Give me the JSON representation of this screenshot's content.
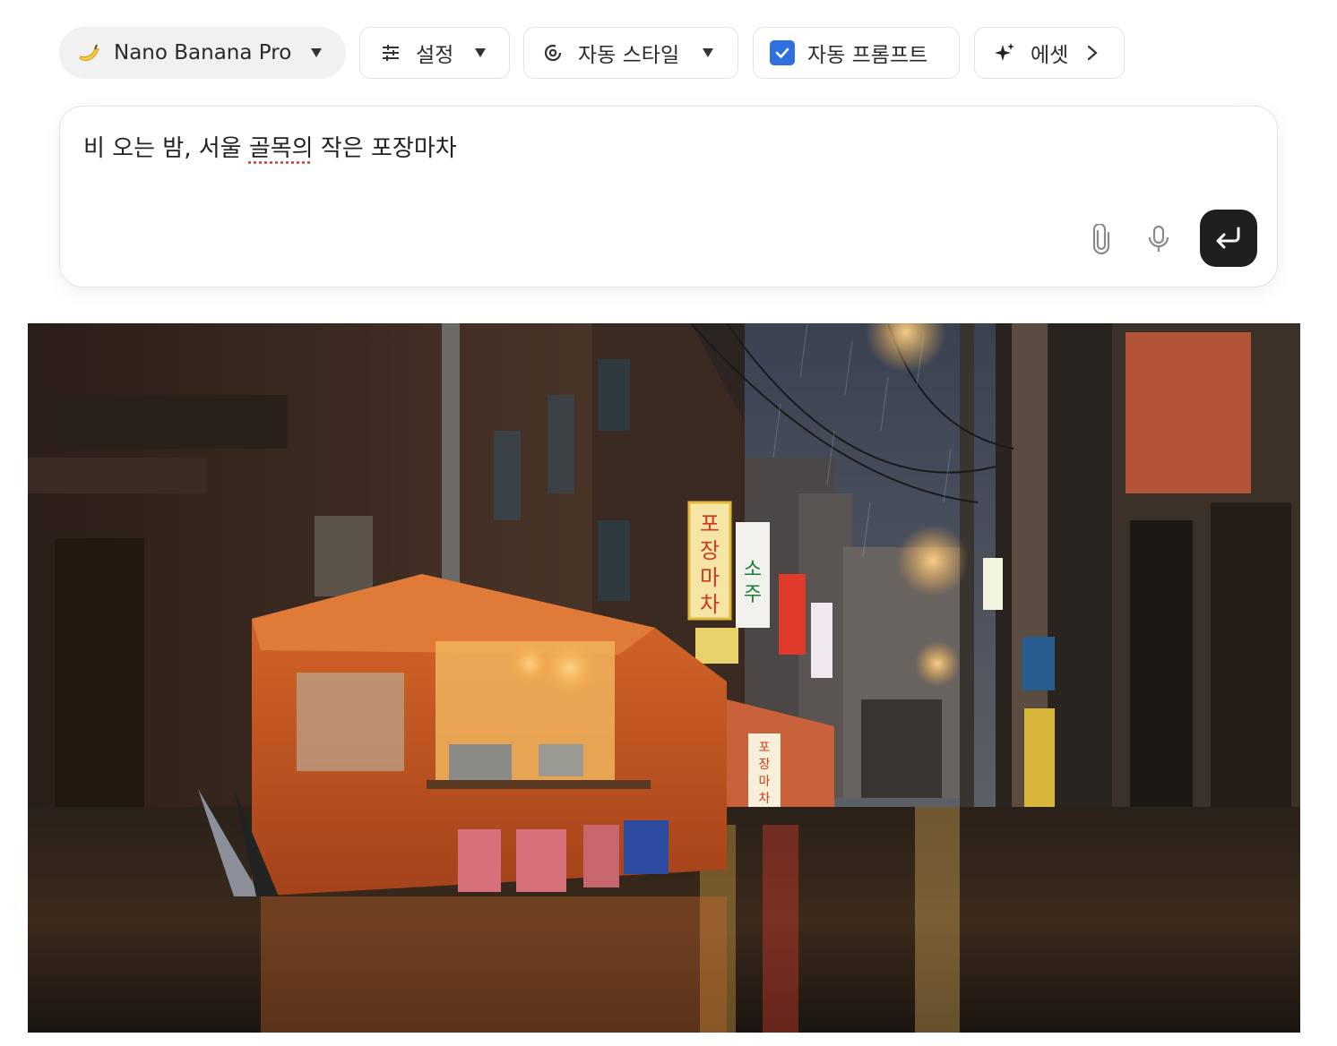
{
  "toolbar": {
    "model": {
      "icon": "banana-icon",
      "label": "Nano Banana Pro"
    },
    "settings": {
      "icon": "sliders-icon",
      "label": "설정"
    },
    "style": {
      "icon": "style-swirl-icon",
      "label": "자동 스타일"
    },
    "auto_prompt": {
      "checked": true,
      "label": "자동 프롬프트"
    },
    "preset": {
      "icon": "sparkle-icon",
      "label": "에셋"
    }
  },
  "composer": {
    "prompt_before": "비 오는 밤, 서울 ",
    "prompt_flagged": "골목의",
    "prompt_after": " 작은 포장마차",
    "attach_icon": "paperclip-icon",
    "mic_icon": "microphone-icon",
    "send_icon": "enter-arrow-icon"
  },
  "colors": {
    "accent_checkbox": "#2f6fde",
    "send_button": "#1f1f1f",
    "tent_orange": "#c8561f"
  },
  "generated_image": {
    "signs": [
      "포장마차",
      "소주",
      "포장마차",
      "포장마차"
    ]
  }
}
